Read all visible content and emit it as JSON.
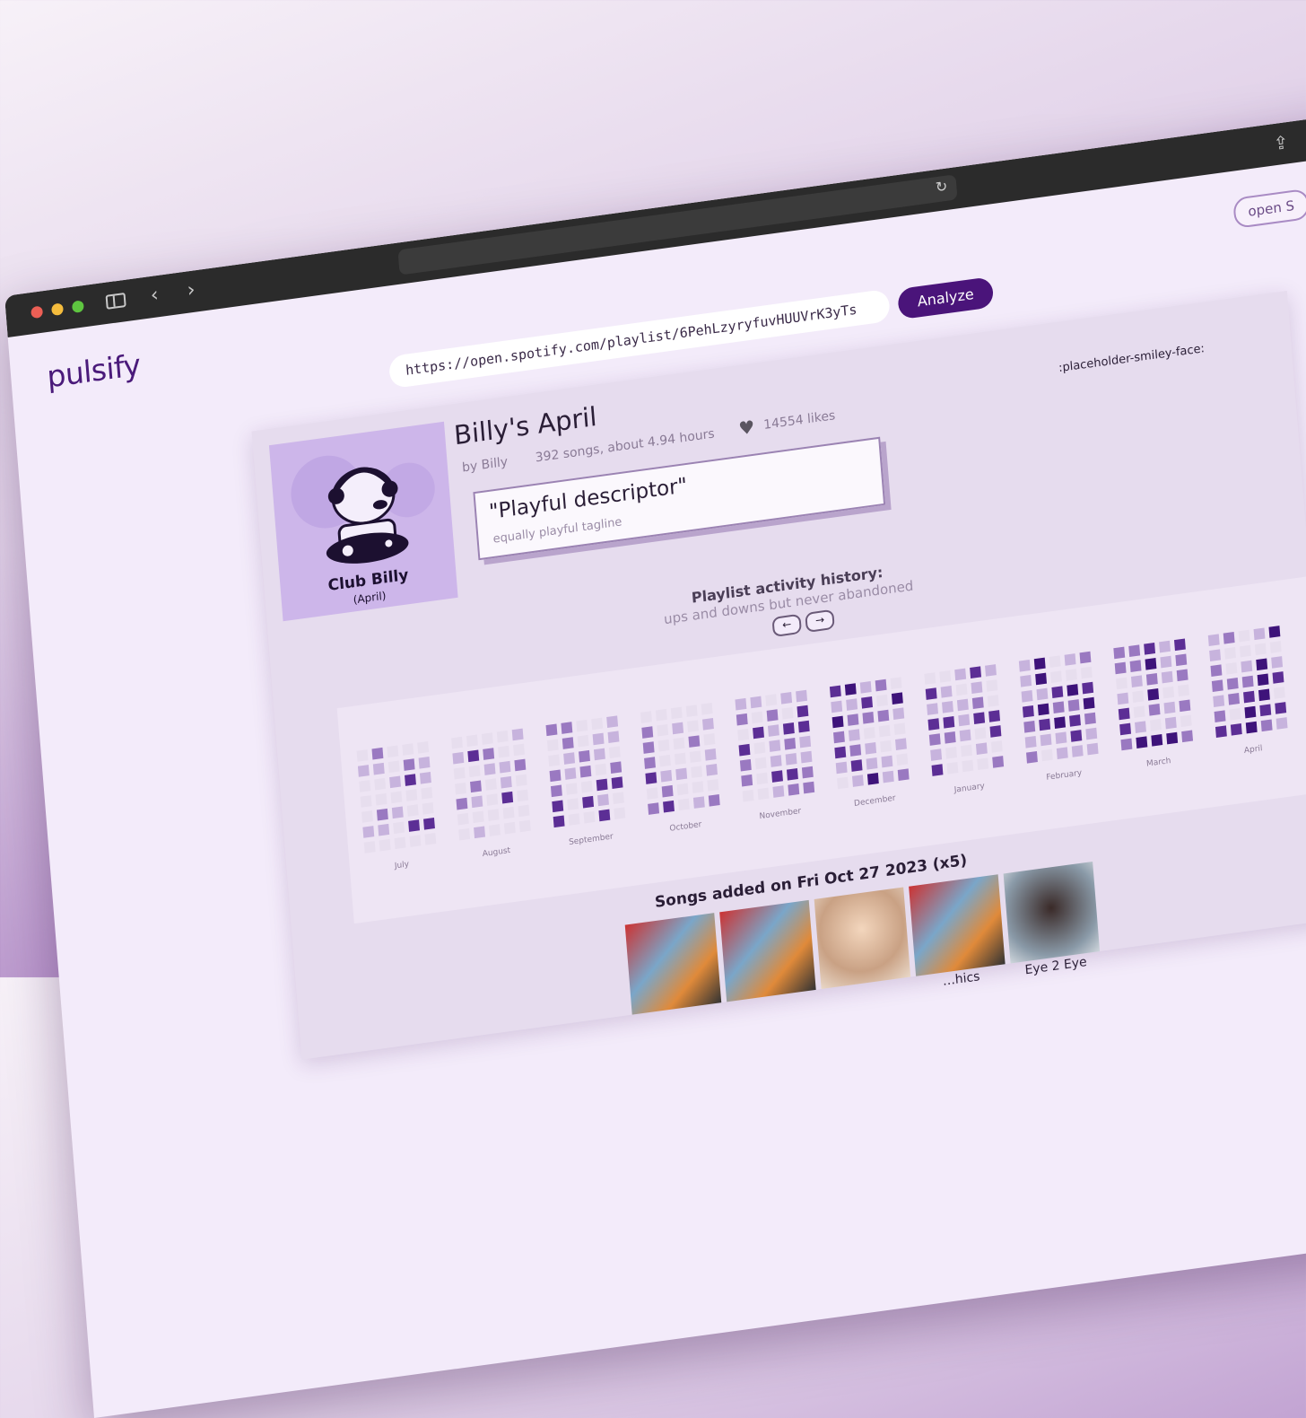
{
  "browser": {
    "share_icon": "share-icon",
    "reload_icon": "reload-icon"
  },
  "app": {
    "logo": "pulsify",
    "open_button": "open S",
    "url_value": "https://open.spotify.com/playlist/6PehLzyryfuvHUUVrK3yTs",
    "analyze_label": "Analyze"
  },
  "playlist": {
    "cover_title": "Club Billy",
    "cover_subtitle": "(April)",
    "title": "Billy's April",
    "owner": "by Billy",
    "meta": "392 songs, about 4.94 hours",
    "likes": "14554 likes",
    "placeholder": ":placeholder-smiley-face:",
    "descriptor": "\"Playful descriptor\"",
    "tagline": "equally playful tagline"
  },
  "activity": {
    "title": "Playlist activity history:",
    "subtitle": "ups and downs but never abandoned",
    "prev_arrow": "←",
    "next_arrow": "→",
    "months": [
      "July",
      "August",
      "September",
      "October",
      "November",
      "December",
      "January",
      "February",
      "March",
      "April"
    ]
  },
  "songs": {
    "title": "Songs added on Fri Oct 27 2023 (x5)",
    "items": [
      "",
      "",
      "",
      "…hics",
      "Eye 2 Eye"
    ]
  },
  "colors": {
    "accent": "#4a147a",
    "cell_empty": "#e7deee",
    "cell_light": "#c7b3dd",
    "cell_mid": "#9a79c1",
    "cell_dark": "#5c2e95",
    "cell_darkest": "#3e137a"
  }
}
